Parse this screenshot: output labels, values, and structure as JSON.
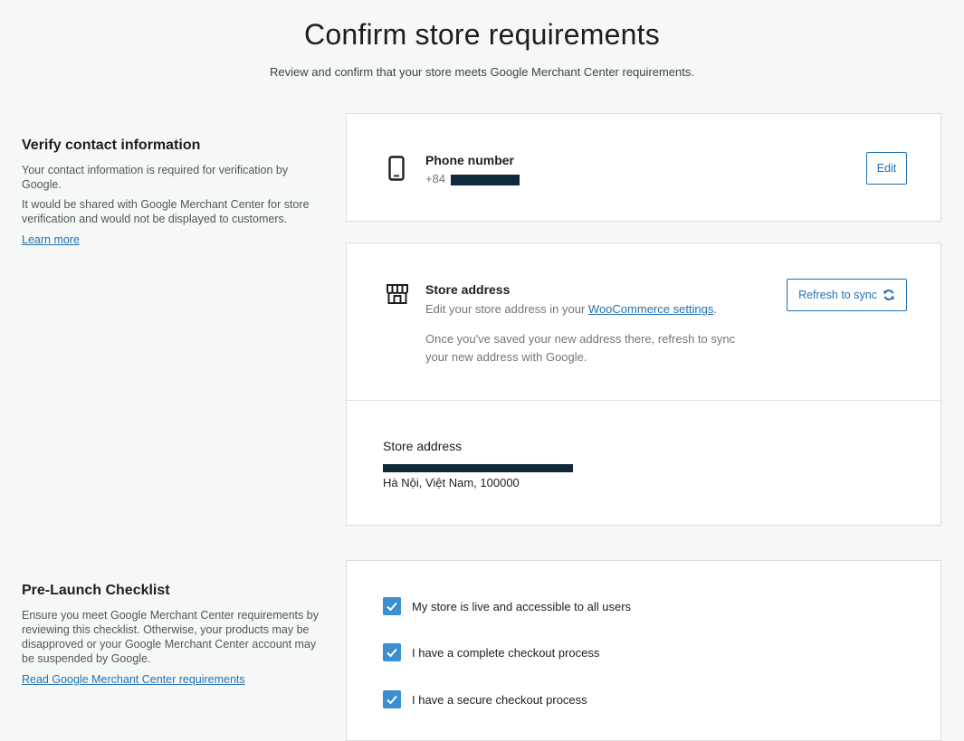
{
  "header": {
    "title": "Confirm store requirements",
    "subtitle": "Review and confirm that your store meets Google Merchant Center requirements."
  },
  "contact_section": {
    "heading": "Verify contact information",
    "desc1": "Your contact information is required for verification by Google.",
    "desc2": "It would be shared with Google Merchant Center for store verification and would not be displayed to customers.",
    "learn_more": "Learn more"
  },
  "phone_card": {
    "title": "Phone number",
    "prefix": "+84",
    "edit_label": "Edit",
    "icon": "smartphone-icon"
  },
  "address_card": {
    "title": "Store address",
    "edit_text_before": "Edit your store address in your ",
    "settings_link": "WooCommerce settings",
    "edit_text_after": ".",
    "sync_note": "Once you've saved your new address there, refresh to sync your new address with Google.",
    "refresh_label": "Refresh to sync",
    "icon": "store-icon",
    "detail_title": "Store address",
    "address_line2": "Hà Nội, Việt Nam, 100000"
  },
  "checklist_section": {
    "heading": "Pre-Launch Checklist",
    "desc": "Ensure you meet Google Merchant Center requirements by reviewing this checklist. Otherwise, your products may be disapproved or your Google Merchant Center account may be suspended by Google.",
    "link": "Read Google Merchant Center requirements"
  },
  "checklist": {
    "items": [
      {
        "label": "My store is live and accessible to all users",
        "checked": true
      },
      {
        "label": "I have a complete checkout process",
        "checked": true
      },
      {
        "label": "I have a secure checkout process",
        "checked": true
      }
    ]
  },
  "colors": {
    "accent": "#2271b1",
    "checkbox": "#3a8fd0",
    "redaction": "#0f2a3a"
  }
}
